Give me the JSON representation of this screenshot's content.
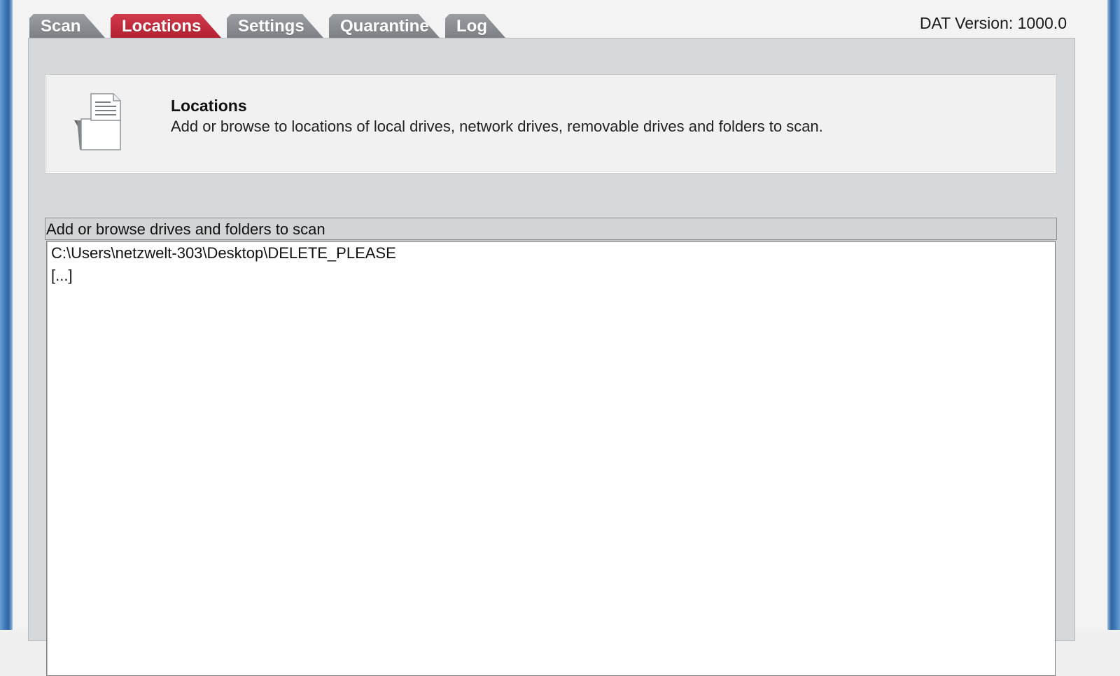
{
  "tabs": [
    {
      "label": "Scan",
      "active": false
    },
    {
      "label": "Locations",
      "active": true
    },
    {
      "label": "Settings",
      "active": false
    },
    {
      "label": "Quarantine",
      "active": false
    },
    {
      "label": "Log",
      "active": false
    }
  ],
  "dat_version": "DAT Version: 1000.0",
  "header": {
    "icon": "document-icon",
    "title": "Locations",
    "description": "Add or browse to locations of local drives, network drives, removable drives and folders to scan."
  },
  "locations": {
    "label": "Add or browse drives and folders to scan",
    "items": [
      "C:\\Users\\netzwelt-303\\Desktop\\DELETE_PLEASE",
      "[...]"
    ]
  },
  "colors": {
    "active_tab": "#c12b3b",
    "inactive_tab": "#8a8e92",
    "panel_bg": "#d6d9db",
    "window_frame": "#3e78b8"
  }
}
